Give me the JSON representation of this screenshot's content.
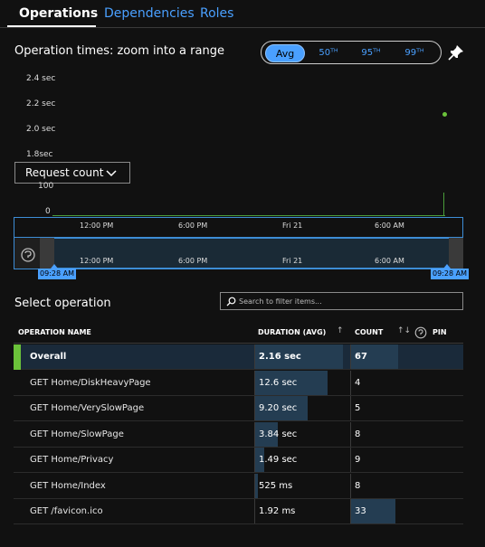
{
  "tabs": [
    {
      "label": "Operations",
      "active": true
    },
    {
      "label": "Dependencies",
      "active": false
    },
    {
      "label": "Roles",
      "active": false
    }
  ],
  "chart": {
    "title": "Operation times: zoom into a range",
    "percentiles": [
      "Avg",
      "50ᵀᴴ",
      "95ᵀᴴ",
      "99ᵀᴴ"
    ],
    "active_percentile": "Avg",
    "y_labels": [
      "2.4 sec",
      "2.2 sec",
      "2.0 sec",
      "1.8sec"
    ],
    "metric_select": "Request count",
    "count_labels": [
      "100",
      "0"
    ],
    "x_labels": [
      "12:00 PM",
      "6:00 PM",
      "Fri 21",
      "6:00 AM"
    ],
    "brush_x_labels": [
      "12:00 PM",
      "6:00 PM",
      "Fri 21",
      "6:00 AM"
    ],
    "range_start": "09:28 AM",
    "range_end": "09:28 AM",
    "series_color": "#6bc23a",
    "accent_color": "#4aa0ff"
  },
  "chart_data": {
    "type": "line",
    "series": [
      {
        "values": [
          {
            "x": "09:28 AM",
            "y": 2.16
          }
        ]
      }
    ],
    "ylabel": "sec",
    "y_ticks": [
      "1.8sec",
      "2.0 sec",
      "2.2 sec",
      "2.4 sec"
    ]
  },
  "operations": {
    "title": "Select operation",
    "filter_placeholder": "Search to filter items...",
    "columns": {
      "name": "OPERATION NAME",
      "duration": "DURATION (AVG)",
      "count": "COUNT",
      "pin": "PIN"
    },
    "rows": [
      {
        "name": "Overall",
        "duration": "2.16 sec",
        "count": "67",
        "dur_frac": 0.98,
        "cnt_frac": 0.5,
        "selected": true
      },
      {
        "name": "GET Home/DiskHeavyPage",
        "duration": "12.6 sec",
        "count": "4",
        "dur_frac": 0.81,
        "cnt_frac": 0.0,
        "selected": false
      },
      {
        "name": "GET Home/VerySlowPage",
        "duration": "9.20 sec",
        "count": "5",
        "dur_frac": 0.59,
        "cnt_frac": 0.0,
        "selected": false
      },
      {
        "name": "GET Home/SlowPage",
        "duration": "3.84 sec",
        "count": "8",
        "dur_frac": 0.25,
        "cnt_frac": 0.0,
        "selected": false
      },
      {
        "name": "GET Home/Privacy",
        "duration": "1.49 sec",
        "count": "9",
        "dur_frac": 0.1,
        "cnt_frac": 0.0,
        "selected": false
      },
      {
        "name": "GET Home/Index",
        "duration": "525 ms",
        "count": "8",
        "dur_frac": 0.03,
        "cnt_frac": 0.0,
        "selected": false
      },
      {
        "name": "GET /favicon.ico",
        "duration": "1.92 ms",
        "count": "33",
        "dur_frac": 0.0,
        "cnt_frac": 0.47,
        "selected": false
      }
    ]
  }
}
